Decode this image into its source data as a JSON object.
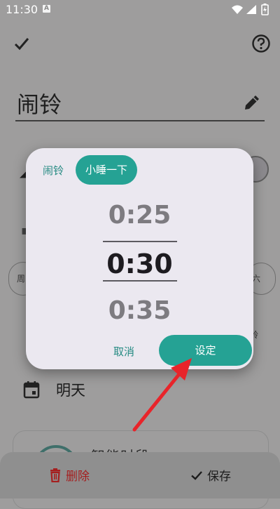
{
  "status_bar": {
    "time": "11:30",
    "notification_letter": "A"
  },
  "header": {
    "title": "闹铃"
  },
  "background": {
    "date_text": "明天",
    "day_left": "周",
    "day_right": "六",
    "card_text": "智能时段"
  },
  "dialog": {
    "tabs": [
      {
        "label": "闹铃"
      },
      {
        "label": "小睡一下"
      }
    ],
    "active_tab": 1,
    "picker": {
      "prev": "0:25",
      "current": "0:30",
      "next": "0:35"
    },
    "cancel_label": "取消",
    "set_label": "设定"
  },
  "bottom_bar": {
    "delete_label": "删除",
    "save_label": "保存"
  },
  "colors": {
    "accent": "#25a294",
    "accent_text": "#258a82",
    "delete": "#a51f1f",
    "annotation_arrow": "#e8242a"
  }
}
